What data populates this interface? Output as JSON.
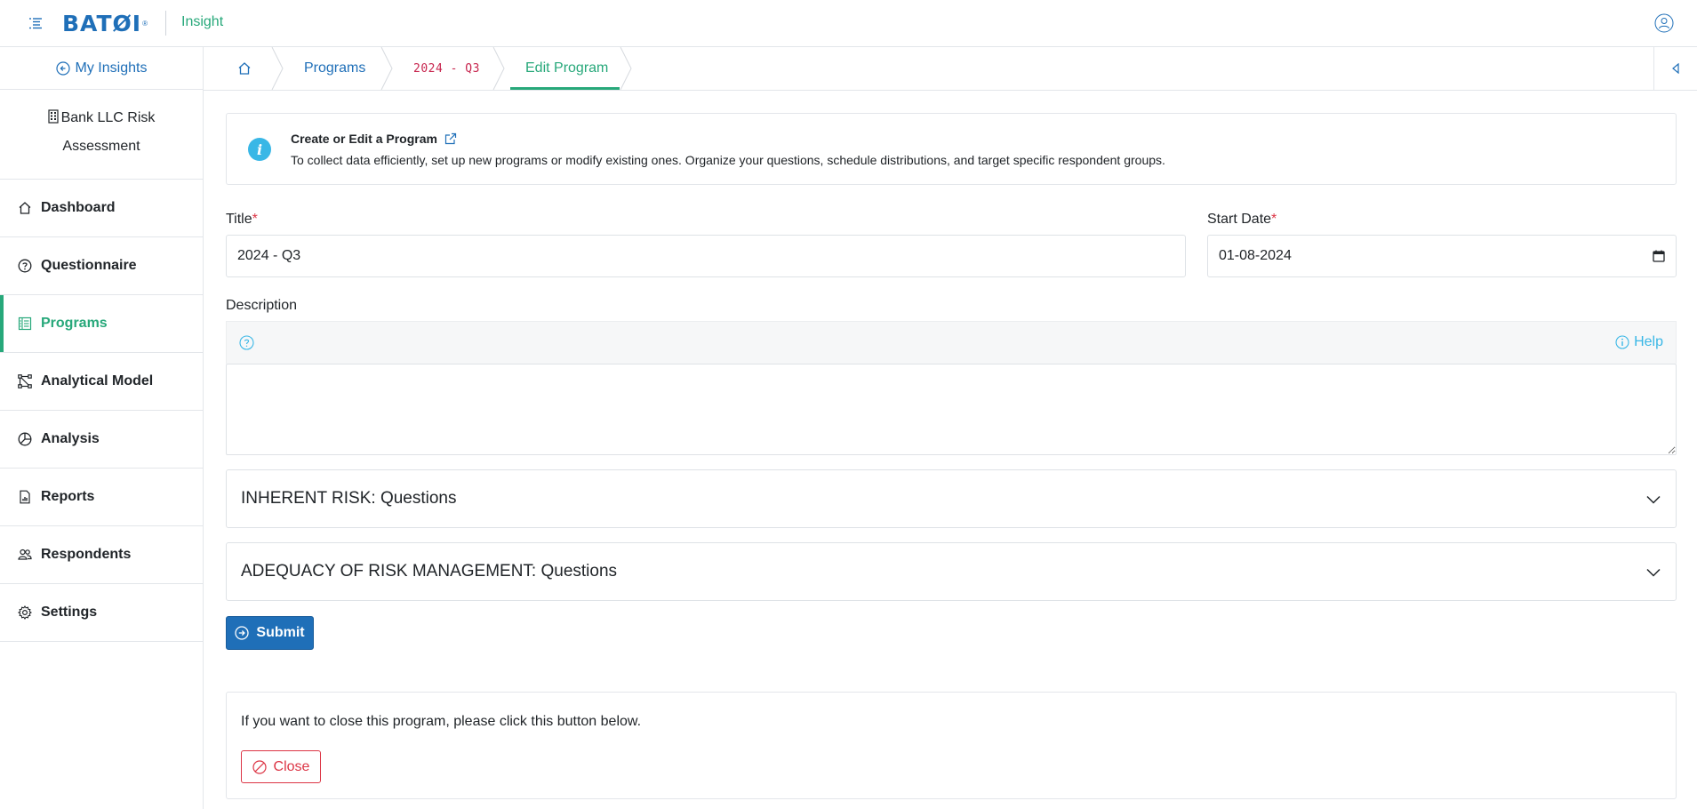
{
  "header": {
    "logo_text": "BATØI",
    "logo_reg": "®",
    "app_name": "Insight"
  },
  "sidebar": {
    "back_label": "My Insights",
    "org_name": "Bank LLC Risk Assessment",
    "items": [
      {
        "label": "Dashboard",
        "icon": "home-icon",
        "active": false
      },
      {
        "label": "Questionnaire",
        "icon": "question-circle-icon",
        "active": false
      },
      {
        "label": "Programs",
        "icon": "list-icon",
        "active": true
      },
      {
        "label": "Analytical Model",
        "icon": "nodes-icon",
        "active": false
      },
      {
        "label": "Analysis",
        "icon": "pie-chart-icon",
        "active": false
      },
      {
        "label": "Reports",
        "icon": "report-icon",
        "active": false
      },
      {
        "label": "Respondents",
        "icon": "people-icon",
        "active": false
      },
      {
        "label": "Settings",
        "icon": "gear-icon",
        "active": false
      }
    ]
  },
  "breadcrumb": {
    "programs": "Programs",
    "program_title": "2024 - Q3",
    "current": "Edit Program"
  },
  "info": {
    "title": "Create or Edit a Program",
    "text": "To collect data efficiently, set up new programs or modify existing ones. Organize your questions, schedule distributions, and target specific respondent groups."
  },
  "form": {
    "title_label": "Title",
    "title_value": "2024 - Q3",
    "start_date_label": "Start Date",
    "start_date_value": "01-08-2024",
    "required_mark": "*",
    "description_label": "Description",
    "help_label": "Help",
    "description_value": ""
  },
  "accordions": [
    {
      "label": "INHERENT RISK: Questions"
    },
    {
      "label": "ADEQUACY OF RISK MANAGEMENT: Questions"
    }
  ],
  "submit_label": "Submit",
  "close_section": {
    "text": "If you want to close this program, please click this button below.",
    "button_label": "Close"
  },
  "colors": {
    "brand_blue": "#1f6fb8",
    "accent_green": "#27a87a",
    "info_cyan": "#39b7e6",
    "danger_red": "#dc3545"
  }
}
